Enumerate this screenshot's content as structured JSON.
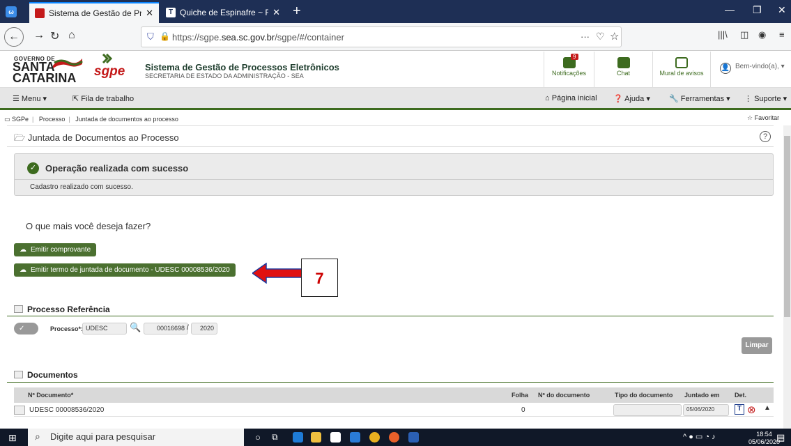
{
  "browser": {
    "tabs": [
      {
        "label": "Sistema de Gestão de Processo",
        "favicon_color": "#c41a1a"
      },
      {
        "label": "Quiche de Espinafre ~ Receita |",
        "favicon_color": "#ffffff"
      }
    ],
    "new_tab_symbol": "+",
    "url_prefix": "https://sgpe.",
    "url_domain": "sea.sc.gov.br",
    "url_suffix": "/sgpe/#/container",
    "url_more": "···"
  },
  "header": {
    "gov_small": "GOVERNO DE",
    "gov_big_1": "SANTA",
    "gov_big_2": "CATARINA",
    "app_logo": "sgpe",
    "title": "Sistema de Gestão de Processos Eletrônicos",
    "subtitle": "SECRETARIA DE ESTADO DA ADMINISTRAÇÃO - SEA",
    "notifications_label": "Notificações",
    "notifications_count": "9",
    "chat_label": "Chat",
    "mural_label": "Mural de avisos",
    "welcome": "Bem-vindo(a),"
  },
  "menubar": {
    "menu": "Menu",
    "fila": "Fila de trabalho",
    "home": "Página inicial",
    "ajuda": "Ajuda",
    "ferramentas": "Ferramentas",
    "suporte": "Suporte"
  },
  "breadcrumb": {
    "root": "SGPe",
    "item1": "Processo",
    "item2": "Juntada de documentos ao processo",
    "favorite": "Favoritar"
  },
  "page": {
    "title": "Juntada de Documentos ao Processo",
    "alert_title": "Operação realizada com sucesso",
    "alert_body": "Cadastro realizado com sucesso.",
    "question": "O que mais você deseja fazer?",
    "btn_comprovante": "Emitir comprovante",
    "btn_termo": "Emitir termo de juntada de documento - UDESC 00008536/2020",
    "callout": "7",
    "section_ref": "Processo Referência",
    "processo_label": "Processo*:",
    "processo_org": "UDESC",
    "processo_num": "00016698",
    "processo_year": "2020",
    "limpar": "Limpar",
    "section_docs": "Documentos",
    "table_headers": {
      "doc": "Nº Documento*",
      "folha": "Folha",
      "num": "Nº do documento",
      "tipo": "Tipo do documento",
      "juntado": "Juntado em",
      "det": "Det."
    },
    "row": {
      "doc": "UDESC 00008536/2020",
      "folha": "0",
      "juntado": "05/06/2020"
    }
  },
  "taskbar": {
    "search": "Digite aqui para pesquisar",
    "time": "18:54",
    "date": "05/06/2020"
  },
  "colors": {
    "brand_green": "#3d6b1f",
    "alert_red": "#c41a1a",
    "callout_red": "#cc0000"
  }
}
